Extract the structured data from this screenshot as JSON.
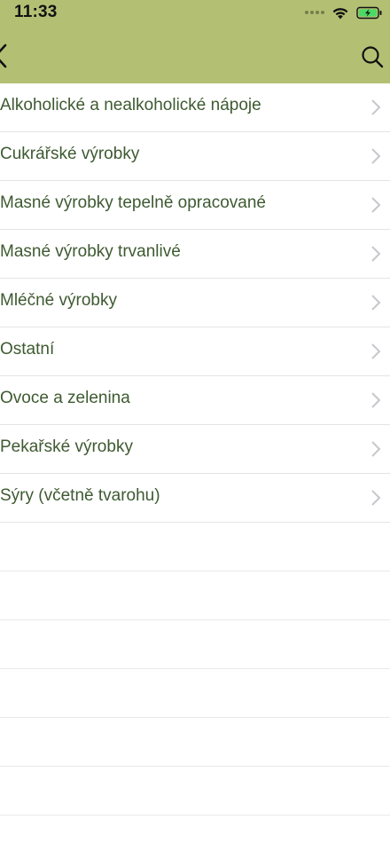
{
  "status_bar": {
    "time": "11:33"
  },
  "colors": {
    "accent": "#b3c074",
    "text": "#3e5a31",
    "chevron": "#c7c7cc"
  },
  "icons": {
    "back": "chevron-left-icon",
    "search": "search-icon",
    "row": "chevron-right-icon",
    "wifi": "wifi-icon",
    "battery": "battery-charging-icon",
    "signal": "signal-dots-icon"
  },
  "categories": [
    "Alkoholické a nealkoholické nápoje",
    "Cukrářské výrobky",
    "Masné výrobky tepelně opracované",
    "Masné výrobky trvanlivé",
    "Mléčné výrobky",
    "Ostatní",
    "Ovoce a zelenina",
    "Pekařské výrobky",
    "Sýry (včetně tvarohu)"
  ]
}
